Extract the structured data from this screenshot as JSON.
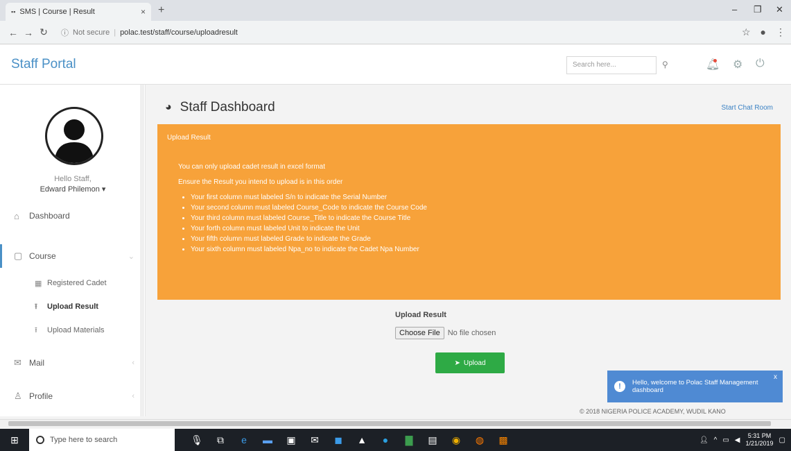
{
  "browser": {
    "tab_title": "SMS | Course | Result",
    "tab_close": "×",
    "new_tab": "+",
    "security": "Not secure",
    "url": "polac.test/staff/course/uploadresult"
  },
  "header": {
    "brand": "Staff Portal",
    "search_placeholder": "Search here..."
  },
  "sidebar": {
    "greeting": "Hello Staff,",
    "user_name": "Edward Philemon ▾",
    "items": [
      {
        "label": "Dashboard"
      },
      {
        "label": "Course"
      },
      {
        "label": "Mail"
      },
      {
        "label": "Profile"
      }
    ],
    "sub_items": [
      {
        "label": "Registered Cadet"
      },
      {
        "label": "Upload Result"
      },
      {
        "label": "Upload Materials"
      }
    ]
  },
  "main": {
    "title": "Staff Dashboard",
    "chat_link": "Start Chat Room",
    "panel_title": "Upload Result",
    "panel_p1": "You can only upload cadet result in excel format",
    "panel_p2": "Ensure the Result you intend to upload is in this order",
    "panel_list": [
      "Your first column must labeled S/n to indicate the Serial Number",
      "Your second column must labeled Course_Code to indicate the Course Code",
      "Your third column must labeled Course_Title to indicate the Course Title",
      "Your forth column must labeled Unit to indicate the Unit",
      "Your fifth column must labeled Grade to indicate the Grade",
      "Your sixth column must labeled Npa_no to indicate the Cadet Npa Number"
    ],
    "upload_label": "Upload Result",
    "choose_file": "Choose File",
    "file_status": "No file chosen",
    "upload_button": "Upload",
    "footer": "© 2018 NIGERIA POLICE ACADEMY, WUDIL KANO"
  },
  "toast": {
    "message": "Hello, welcome to Polac Staff Management dashboard",
    "close": "x"
  },
  "taskbar": {
    "search_placeholder": "Type here to search",
    "time": "5:31 PM",
    "date": "1/21/2019"
  },
  "colors": {
    "brand": "#4a90c6",
    "panel": "#f7a23a",
    "upload_button": "#2eaa45",
    "toast": "#4f8ad3"
  }
}
